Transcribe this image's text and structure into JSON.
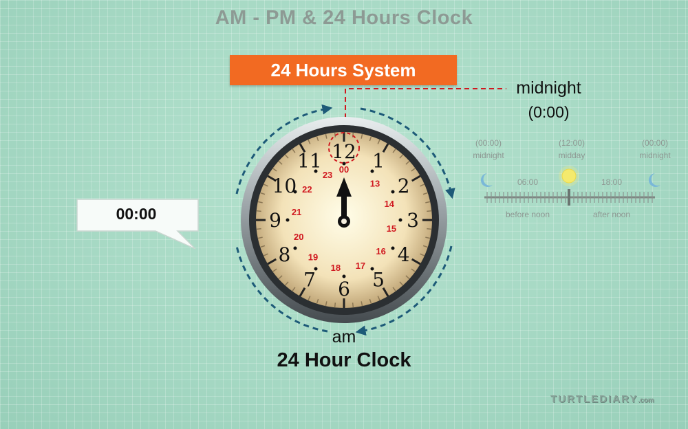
{
  "title": "AM - PM & 24 Hours Clock",
  "banner": "24 Hours System",
  "callout": {
    "label": "midnight",
    "time": "(0:00)"
  },
  "bubble": {
    "text": "00:00"
  },
  "clock": {
    "hour_numerals": [
      "12",
      "1",
      "2",
      "3",
      "4",
      "5",
      "6",
      "7",
      "8",
      "9",
      "10",
      "11"
    ],
    "hour24_labels": [
      "00",
      "13",
      "14",
      "15",
      "16",
      "17",
      "18",
      "19",
      "20",
      "21",
      "22",
      "23"
    ],
    "hand_position": "12"
  },
  "timeline": {
    "top_labels": [
      {
        "time": "(00:00)",
        "label": "midnight"
      },
      {
        "time": "(12:00)",
        "label": "midday"
      },
      {
        "time": "(00:00)",
        "label": "midnight"
      }
    ],
    "ticks": [
      "06:00",
      "18:00"
    ],
    "bottom_labels": [
      "before noon",
      "after noon"
    ]
  },
  "am_label": "am",
  "caption": "24 Hour Clock",
  "logo": {
    "main": "TURTLEDIARY",
    "suffix": ".com"
  },
  "colors": {
    "accent": "#f26a22",
    "background": "#a9dbc7",
    "arrows": "#1d5a78",
    "numerals_24": "#d0181f",
    "guide": "#d0181f"
  }
}
